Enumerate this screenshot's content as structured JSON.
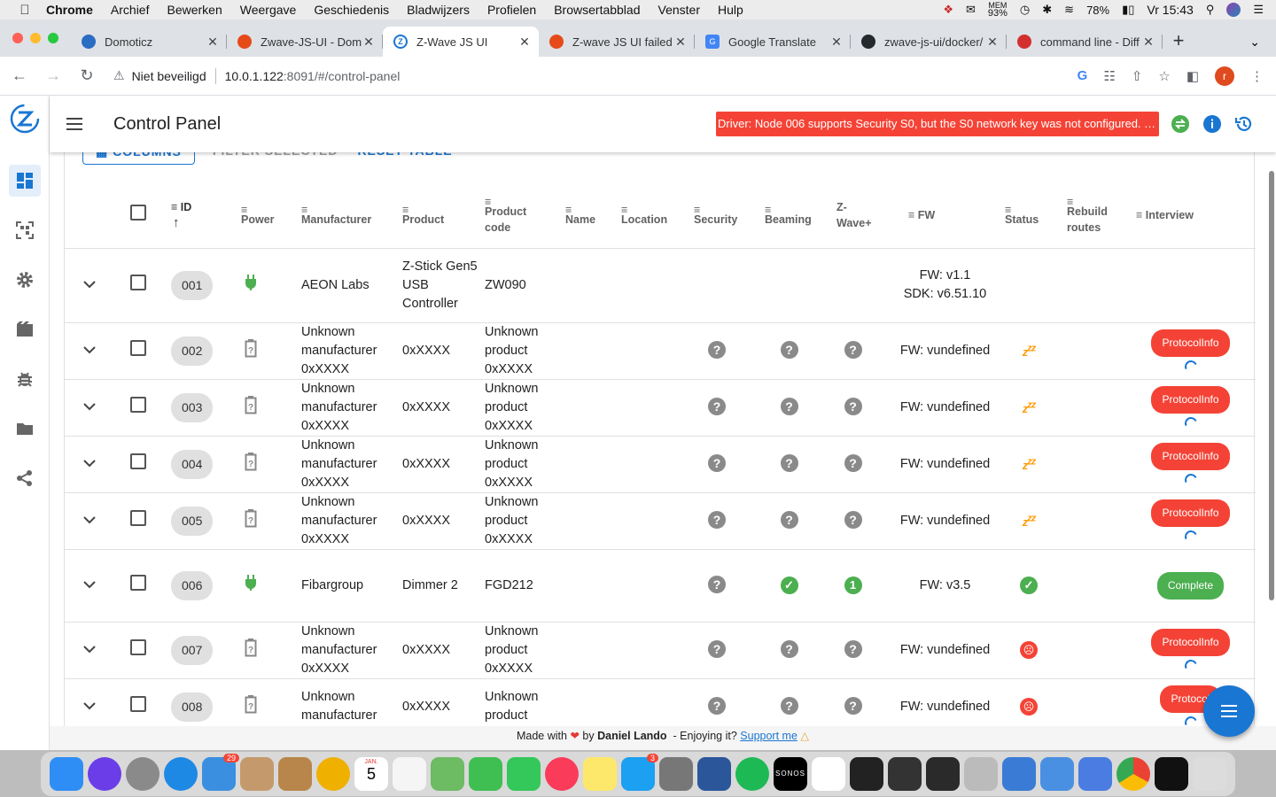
{
  "menubar": {
    "app": "Chrome",
    "items": [
      "Archief",
      "Bewerken",
      "Weergave",
      "Geschiedenis",
      "Bladwijzers",
      "Profielen",
      "Browsertabblad",
      "Venster",
      "Hulp"
    ],
    "mem_label": "MEM",
    "mem_value": "93%",
    "battery": "78%",
    "clock": "Vr 15:43"
  },
  "browser_tabs": [
    {
      "title": "Domoticz",
      "color": "#2b6cc4"
    },
    {
      "title": "Zwave-JS-UI - Dom",
      "color": "#e64a19"
    },
    {
      "title": "Z-Wave JS UI",
      "color": "#1976d2"
    },
    {
      "title": "Z-wave JS UI failed",
      "color": "#e64a19"
    },
    {
      "title": "Google Translate",
      "color": "#4285f4"
    },
    {
      "title": "zwave-js-ui/docker/",
      "color": "#24292e"
    },
    {
      "title": "command line - Diff",
      "color": "#d32f2f"
    }
  ],
  "address": {
    "insecure_label": "Niet beveiligd",
    "url_host": "10.0.1.122",
    "url_rest": ":8091/#/control-panel",
    "profile_initial": "r"
  },
  "app": {
    "page_title": "Control Panel",
    "alert_text": "Driver: Node 006 supports Security S0, but the S0 network key was not configured. The interview might fail or the device may not work correctly.",
    "table_buttons": {
      "columns": "COLUMNS",
      "filter": "FILTER SELECTED",
      "reset": "RESET TABLE"
    },
    "columns": {
      "id": "ID",
      "power": "Power",
      "manufacturer": "Manufacturer",
      "product": "Product",
      "product_code": "Product code",
      "name": "Name",
      "location": "Location",
      "security": "Security",
      "beaming": "Beaming",
      "zwave_plus": "Z-Wave+",
      "fw": "FW",
      "status": "Status",
      "rebuild": "Rebuild routes",
      "interview": "Interview"
    },
    "rows": [
      {
        "id": "001",
        "power": "mains",
        "manufacturer": "AEON Labs",
        "product": "Z-Stick Gen5 USB Controller",
        "product_code": "ZW090",
        "security": "",
        "beaming": "",
        "zwave_plus": "",
        "fw": "FW: v1.1",
        "sdk": "SDK: v6.51.10",
        "status": "",
        "interview": ""
      },
      {
        "id": "002",
        "power": "battery",
        "manufacturer": "Unknown manufacturer 0xXXXX",
        "product": "0xXXXX",
        "product_code": "Unknown product 0xXXXX",
        "security": "unknown",
        "beaming": "unknown",
        "zwave_plus": "unknown",
        "fw": "FW: vundefined",
        "sdk": "",
        "status": "asleep",
        "interview": "ProtocolInfo"
      },
      {
        "id": "003",
        "power": "battery",
        "manufacturer": "Unknown manufacturer 0xXXXX",
        "product": "0xXXXX",
        "product_code": "Unknown product 0xXXXX",
        "security": "unknown",
        "beaming": "unknown",
        "zwave_plus": "unknown",
        "fw": "FW: vundefined",
        "sdk": "",
        "status": "asleep",
        "interview": "ProtocolInfo"
      },
      {
        "id": "004",
        "power": "battery",
        "manufacturer": "Unknown manufacturer 0xXXXX",
        "product": "0xXXXX",
        "product_code": "Unknown product 0xXXXX",
        "security": "unknown",
        "beaming": "unknown",
        "zwave_plus": "unknown",
        "fw": "FW: vundefined",
        "sdk": "",
        "status": "asleep",
        "interview": "ProtocolInfo"
      },
      {
        "id": "005",
        "power": "battery",
        "manufacturer": "Unknown manufacturer 0xXXXX",
        "product": "0xXXXX",
        "product_code": "Unknown product 0xXXXX",
        "security": "unknown",
        "beaming": "unknown",
        "zwave_plus": "unknown",
        "fw": "FW: vundefined",
        "sdk": "",
        "status": "asleep",
        "interview": "ProtocolInfo"
      },
      {
        "id": "006",
        "power": "mains",
        "manufacturer": "Fibargroup",
        "product": "Dimmer 2",
        "product_code": "FGD212",
        "security": "unknown",
        "beaming": "yes",
        "zwave_plus": "1",
        "fw": "FW: v3.5",
        "sdk": "",
        "status": "alive",
        "interview": "Complete"
      },
      {
        "id": "007",
        "power": "battery",
        "manufacturer": "Unknown manufacturer 0xXXXX",
        "product": "0xXXXX",
        "product_code": "Unknown product 0xXXXX",
        "security": "unknown",
        "beaming": "unknown",
        "zwave_plus": "unknown",
        "fw": "FW: vundefined",
        "sdk": "",
        "status": "dead",
        "interview": "ProtocolInfo"
      },
      {
        "id": "008",
        "power": "battery",
        "manufacturer": "Unknown manufacturer",
        "product": "0xXXXX",
        "product_code": "Unknown product",
        "security": "unknown",
        "beaming": "unknown",
        "zwave_plus": "unknown",
        "fw": "FW: vundefined",
        "sdk": "",
        "status": "dead",
        "interview": "Protocol"
      }
    ],
    "footer": {
      "made_with": "Made with",
      "by": "by",
      "author": "Daniel Lando",
      "enjoy": "- Enjoying it?",
      "support": "Support me"
    }
  },
  "dock": {
    "badges": {
      "mail": "29",
      "appstore": "3"
    },
    "calendar_month": "JAN.",
    "calendar_day": "5",
    "sonos": "SONOS"
  },
  "colors": {
    "primary": "#1976d2",
    "error": "#f44336",
    "success": "#4caf50",
    "warning": "#ff9800"
  }
}
